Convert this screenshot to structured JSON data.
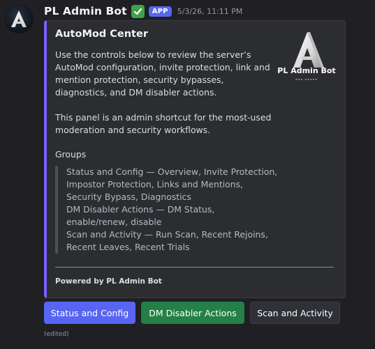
{
  "message": {
    "bot_name": "PL Admin Bot",
    "badge": "APP",
    "timestamp": "5/3/26, 11:11 PM",
    "edited_label": "(edited)"
  },
  "embed": {
    "accent_color": "#7b61ff",
    "title": "AutoMod Center",
    "description_1": "Use the controls below to review the server’s AutoMod configuration, invite protection, link and mention protection, security bypasses, diagnostics, and DM disabler actions.",
    "description_2": "This panel is an admin shortcut for the most-used moderation and security workflows.",
    "groups_title": "Groups",
    "groups": [
      "Status and Config — Overview, Invite Protection, Impostor Protection, Links and Mentions, Security Bypass, Diagnostics",
      "DM Disabler Actions — DM Status, enable/renew, disable",
      "Scan and Activity — Run Scan, Recent Rejoins, Recent Leaves, Recent Trials"
    ],
    "thumbnail_label": "PL Admin Bot",
    "footer": "Powered by PL Admin Bot"
  },
  "buttons": {
    "status_config": "Status and Config",
    "dm_disabler": "DM Disabler Actions",
    "scan_activity": "Scan and Activity"
  },
  "colors": {
    "primary": "#5865f2",
    "success": "#248046",
    "secondary": "#303136",
    "verified": "#3fa24a"
  },
  "icons": {
    "avatar": "letter-a-logo",
    "verified": "check-mark-icon",
    "thumbnail": "letter-a-logo"
  }
}
